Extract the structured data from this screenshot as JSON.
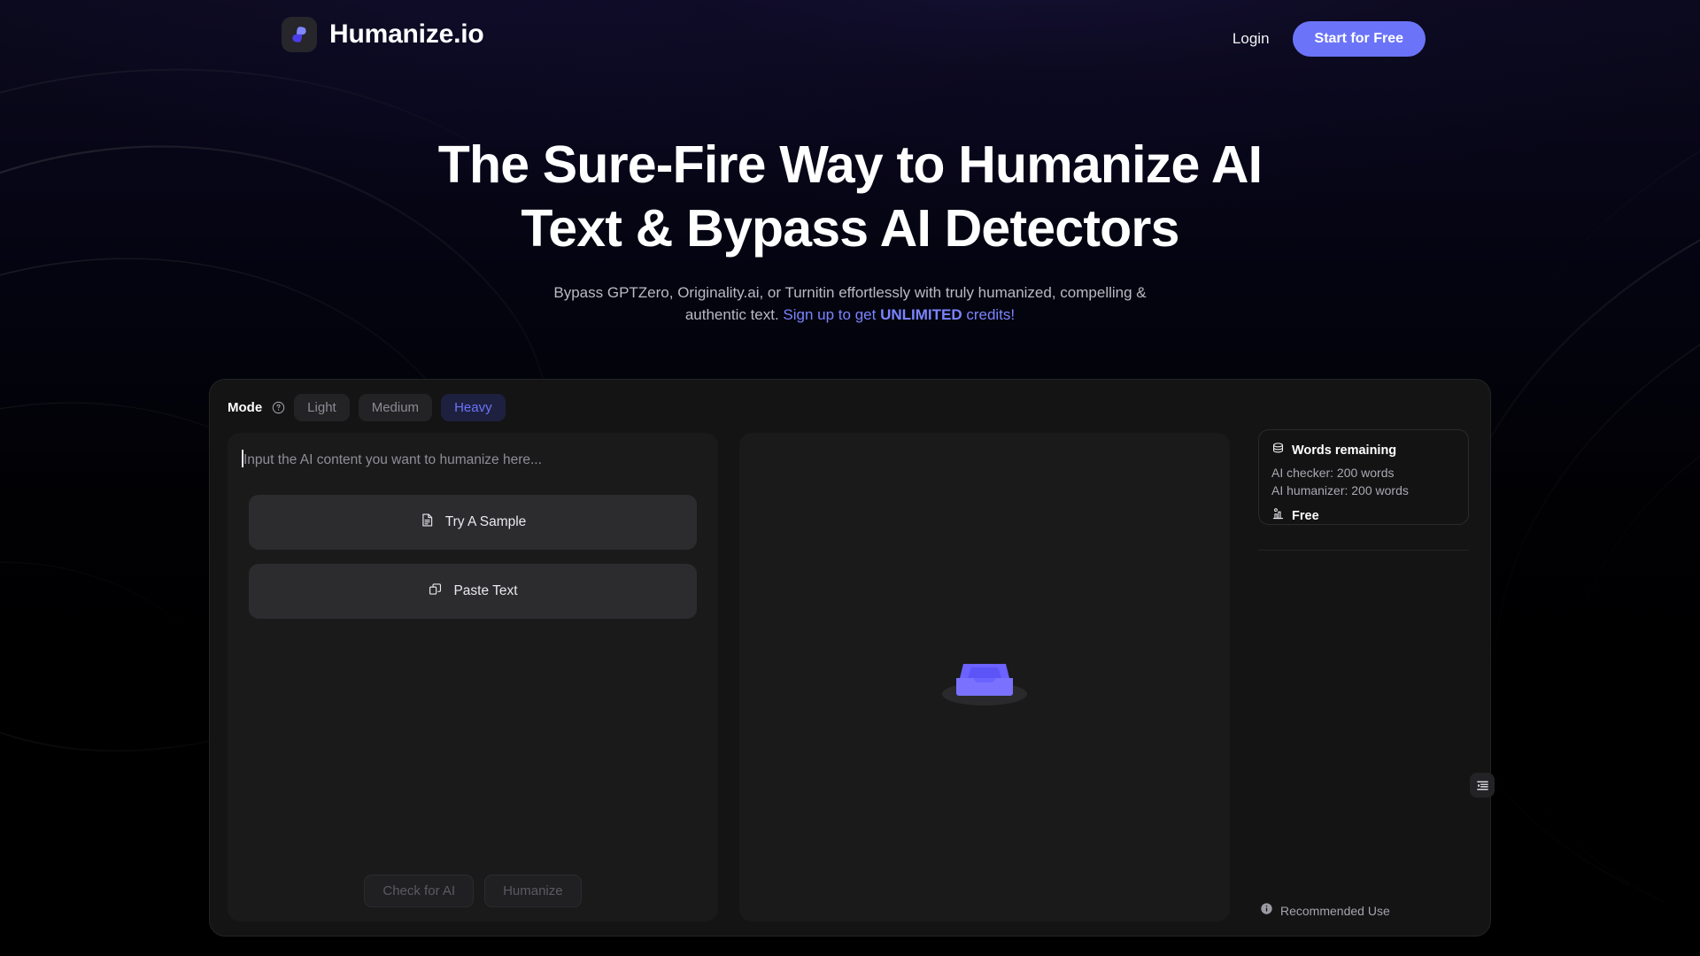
{
  "brand": {
    "name": "Humanize.io",
    "logo_icon": "humanize-leaf-logo-icon",
    "accent": "#6b74f8"
  },
  "nav": {
    "login_label": "Login",
    "cta_label": "Start for Free"
  },
  "hero": {
    "title_line1": "The Sure-Fire Way to Humanize AI",
    "title_line2": "Text & Bypass AI Detectors",
    "sub_part1": "Bypass GPTZero, Originality.ai, or Turnitin effortlessly with truly humanized, compelling & authentic text. ",
    "sub_link_pre": "Sign up to get ",
    "sub_link_strong": "UNLIMITED",
    "sub_link_post": " credits!",
    "link_color": "#7b84ff"
  },
  "tool": {
    "mode": {
      "label": "Mode",
      "help_icon": "question-circle-icon",
      "options": [
        {
          "label": "Light",
          "active": false
        },
        {
          "label": "Medium",
          "active": false
        },
        {
          "label": "Heavy",
          "active": true
        }
      ],
      "selected": "Heavy",
      "active_color": "#6b74f8"
    },
    "input": {
      "placeholder": "Input the AI content you want to humanize here...",
      "value": "",
      "focused": true
    },
    "helpers": [
      {
        "label": "Try A Sample",
        "icon": "document-text-icon"
      },
      {
        "label": "Paste Text",
        "icon": "copy-paste-icon"
      }
    ],
    "actions": [
      {
        "label": "Check for AI",
        "disabled": true
      },
      {
        "label": "Humanize",
        "disabled": true
      }
    ],
    "output": {
      "empty_icon": "inbox-tray-icon",
      "empty_icon_color": "#5b51f0",
      "text": ""
    }
  },
  "sidebar": {
    "toggle_icon": "list-menu-icon",
    "credits": {
      "icon": "coins-stack-icon",
      "title": "Words remaining",
      "lines": [
        "AI checker: 200 words",
        "AI humanizer: 200 words"
      ],
      "plan_icon": "plan-chart-icon",
      "plan_label": "Free"
    },
    "footer": {
      "icon": "info-circle-icon",
      "label": "Recommended Use"
    }
  }
}
